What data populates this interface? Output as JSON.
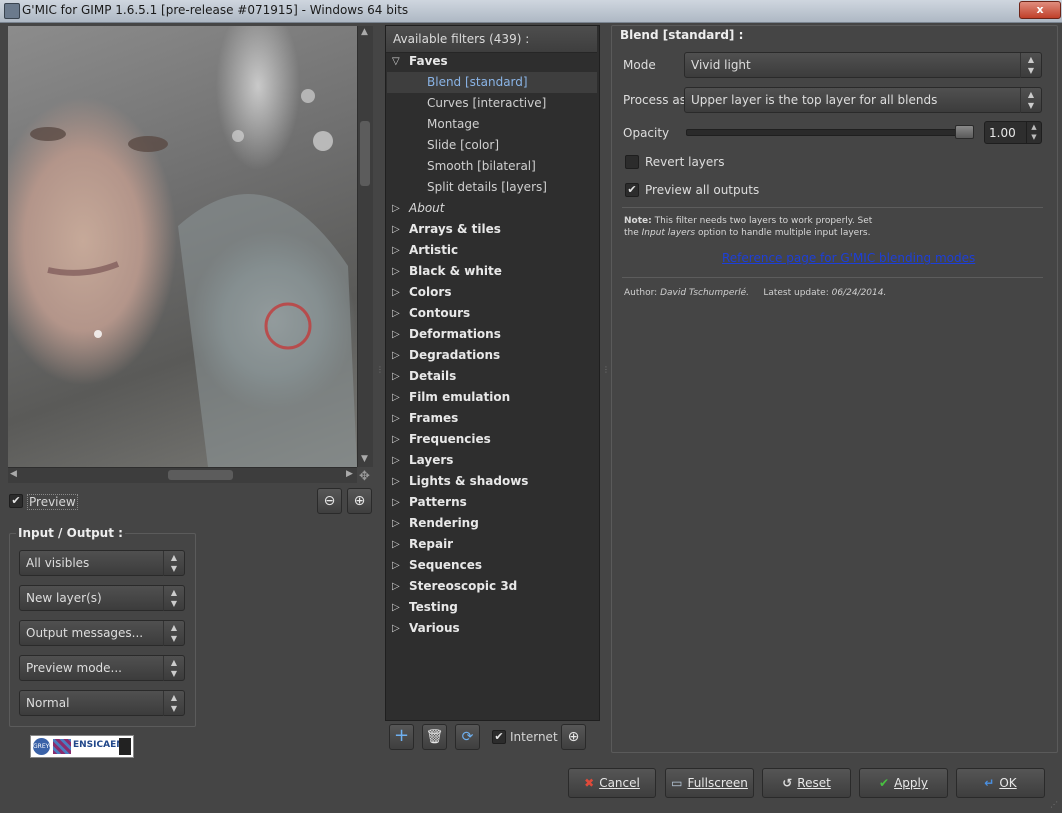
{
  "window": {
    "title": "G'MIC for GIMP 1.6.5.1 [pre-release #071915] - Windows 64 bits",
    "close_label": "x"
  },
  "preview": {
    "checkbox_label": "Preview",
    "checked": true
  },
  "io": {
    "title": "Input / Output :",
    "combos": [
      "All visibles",
      "New layer(s)",
      "Output messages...",
      "Preview mode...",
      "Normal"
    ]
  },
  "logo": {
    "text": "ENSICAEN",
    "circle_text": "GREYC"
  },
  "filters": {
    "header": "Available filters (439) :",
    "faves_label": "Faves",
    "faves": [
      "Blend [standard]",
      "Curves [interactive]",
      "Montage",
      "Slide [color]",
      "Smooth [bilateral]",
      "Split details [layers]"
    ],
    "about_label": "About",
    "categories": [
      "Arrays & tiles",
      "Artistic",
      "Black & white",
      "Colors",
      "Contours",
      "Deformations",
      "Degradations",
      "Details",
      "Film emulation",
      "Frames",
      "Frequencies",
      "Layers",
      "Lights & shadows",
      "Patterns",
      "Rendering",
      "Repair",
      "Sequences",
      "Stereoscopic 3d",
      "Testing",
      "Various"
    ],
    "internet_label": "Internet",
    "internet_checked": true
  },
  "filter_params": {
    "title": "Blend [standard] :",
    "mode_label": "Mode",
    "mode_value": "Vivid light",
    "process_label": "Process as",
    "process_value": "Upper layer is the top layer for all blends",
    "opacity_label": "Opacity",
    "opacity_value": "1.00",
    "revert_label": "Revert layers",
    "revert_checked": false,
    "preview_all_label": "Preview all outputs",
    "preview_all_checked": true,
    "note_bold": "Note:",
    "note_line1": "This filter needs two layers to work properly. Set",
    "note_line2a": "the ",
    "note_line2_italic": "Input layers",
    "note_line2b": " option to handle multiple input layers.",
    "reference_link": "Reference page for G'MIC blending modes",
    "author_label": "Author:",
    "author_name": "David Tschumperlé.",
    "update_label": "Latest update:",
    "update_date": "06/24/2014."
  },
  "buttons": {
    "cancel": "Cancel",
    "fullscreen": "Fullscreen",
    "reset": "Reset",
    "apply": "Apply",
    "ok": "OK"
  },
  "colors": {
    "bg": "#454545",
    "list_bg": "#2e2e2e",
    "selected_text": "#8ab4e6",
    "link": "#1d3fd8",
    "cancel_icon": "#e04a3a",
    "apply_icon": "#48c040",
    "ok_icon": "#4a90e2"
  }
}
